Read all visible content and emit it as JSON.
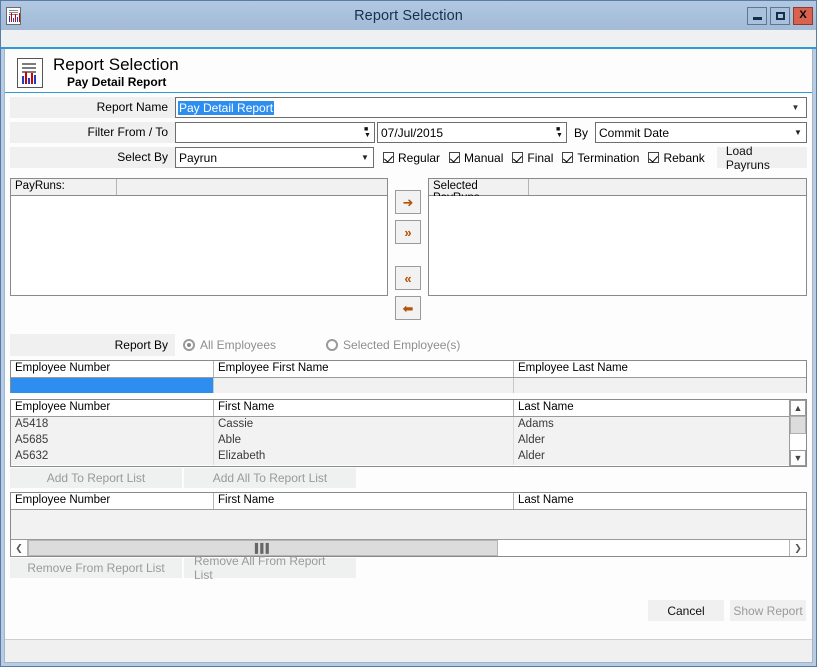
{
  "window": {
    "title": "Report Selection",
    "icon": "report-document-icon",
    "buttons": {
      "minimize": "minimize-icon",
      "maximize": "maximize-icon",
      "close": "X"
    }
  },
  "page_header": {
    "icon": "report-document-icon",
    "title": "Report Selection",
    "subtitle": "Pay Detail Report"
  },
  "form": {
    "report_name": {
      "label": "Report Name",
      "value": "Pay Detail Report"
    },
    "filter_from_to": {
      "label": "Filter From / To",
      "from_value": "",
      "to_value": "07/Jul/2015",
      "by_label": "By",
      "by_value": "Commit Date"
    },
    "select_by": {
      "label": "Select By",
      "value": "Payrun",
      "checkboxes": [
        {
          "label": "Regular",
          "checked": true
        },
        {
          "label": "Manual",
          "checked": true
        },
        {
          "label": "Final",
          "checked": true
        },
        {
          "label": "Termination",
          "checked": true
        },
        {
          "label": "Rebank",
          "checked": true
        }
      ],
      "load_button": "Load Payruns"
    }
  },
  "payruns": {
    "available_header": "PayRuns:",
    "selected_header": "Selected PayRuns",
    "available_items": [],
    "selected_items": [],
    "transfer_buttons": [
      {
        "name": "move-right-button",
        "glyph": "➜"
      },
      {
        "name": "move-all-right-button",
        "glyph": "»"
      },
      {
        "name": "move-all-left-button",
        "glyph": "«"
      },
      {
        "name": "move-left-button",
        "glyph": "⬅"
      }
    ]
  },
  "report_by": {
    "label": "Report By",
    "options": [
      {
        "label": "All Employees",
        "selected": true
      },
      {
        "label": "Selected Employee(s)",
        "selected": false
      }
    ]
  },
  "filter_grid": {
    "headers": [
      "Employee Number",
      "Employee First Name",
      "Employee Last Name"
    ],
    "filter_row": [
      "",
      "",
      ""
    ]
  },
  "employee_grid": {
    "headers": [
      "Employee Number",
      "First Name",
      "Last Name"
    ],
    "rows": [
      {
        "number": "A5418",
        "first": "Cassie",
        "last": "Adams"
      },
      {
        "number": "A5685",
        "first": "Able",
        "last": "Alder"
      },
      {
        "number": "A5632",
        "first": "Elizabeth",
        "last": "Alder"
      }
    ]
  },
  "add_actions": {
    "add_to_report_list": "Add To Report List",
    "add_all_to_report_list": "Add All To Report List"
  },
  "report_list_grid": {
    "headers": [
      "Employee Number",
      "First Name",
      "Last Name"
    ],
    "rows": []
  },
  "remove_actions": {
    "remove_from_report_list": "Remove From Report List",
    "remove_all_from_report_list": "Remove All From Report List"
  },
  "footer": {
    "cancel": "Cancel",
    "show_report": "Show Report"
  },
  "colors": {
    "titlebar": "#a9c0dc",
    "accent_blue": "#2e9ad6",
    "selection_blue": "#2d8ef0",
    "arrow_orange": "#b0530b",
    "close_red": "#d9614f"
  }
}
